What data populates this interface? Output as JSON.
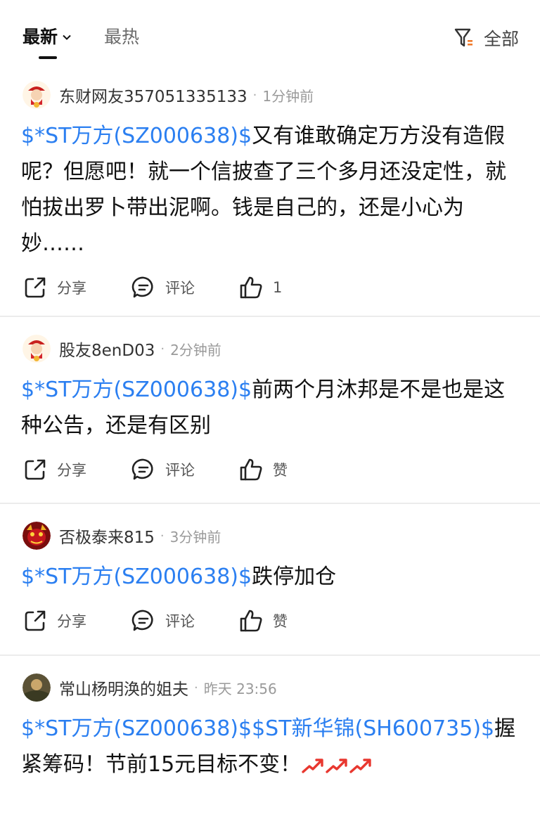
{
  "tabs": {
    "latest": "最新",
    "hot": "最热"
  },
  "filter": {
    "label": "全部"
  },
  "colors": {
    "accent_blue": "#2b7ff1",
    "trend_red": "#e8372f"
  },
  "posts": [
    {
      "author": "东财网友357051335133",
      "time": "1分钟前",
      "stocks": "$*ST万方(SZ000638)$",
      "text": "又有谁敢确定万方没有造假呢？但愿吧！就一个信披查了三个多月还没定性，就怕拔出罗卜带出泥啊。钱是自己的，还是小心为妙……",
      "share": "分享",
      "comment": "评论",
      "like": "1"
    },
    {
      "author": "股友8enD03",
      "time": "2分钟前",
      "stocks": "$*ST万方(SZ000638)$",
      "text": "前两个月沐邦是不是也是这种公告，还是有区别",
      "share": "分享",
      "comment": "评论",
      "like": "赞"
    },
    {
      "author": "否极泰来815",
      "time": "3分钟前",
      "stocks": "$*ST万方(SZ000638)$",
      "text": "跌停加仓",
      "share": "分享",
      "comment": "评论",
      "like": "赞"
    },
    {
      "author": "常山杨明涣的姐夫",
      "time": "昨天 23:56",
      "stocks": "$*ST万方(SZ000638)$$ST新华锦(SH600735)$",
      "text": "握紧筹码！节前15元目标不变！",
      "emoji": "trend-up-arrows"
    }
  ]
}
